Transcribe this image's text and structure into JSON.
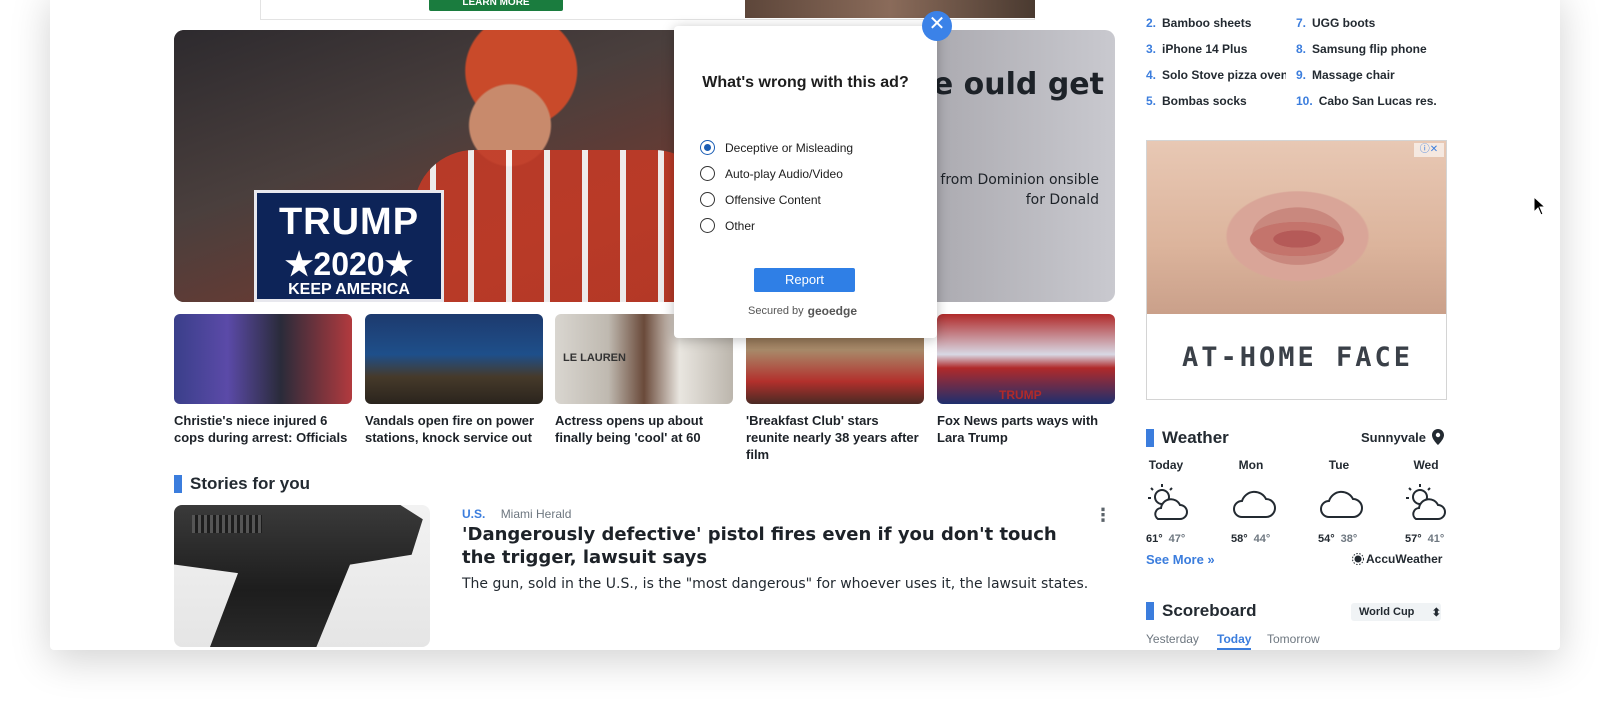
{
  "top_ad": {
    "button_label": "LEARN MORE"
  },
  "hero": {
    "title": "ght case ould get",
    "summary": "ws of amplifying bogus es from Dominion onsible for Donald",
    "sign_line1": "TRUMP",
    "sign_line2": "★2020★",
    "sign_line3": "KEEP AMERICA"
  },
  "thumbs": [
    {
      "caption": "Christie's niece injured 6 cops during arrest: Officials"
    },
    {
      "caption": "Vandals open fire on power stations, knock service out"
    },
    {
      "caption": "Actress opens up about finally being 'cool' at 60",
      "img_text": "LE  LAUREN"
    },
    {
      "caption": "'Breakfast Club' stars reunite nearly 38 years after film"
    },
    {
      "caption": "Fox News parts ways with Lara Trump",
      "img_text": "TRUMP"
    }
  ],
  "stories_header": "Stories for you",
  "story": {
    "category": "U.S.",
    "source": "Miami Herald",
    "title": "'Dangerously defective' pistol fires even if you don't touch the trigger, lawsuit says",
    "summary": "The gun, sold in the U.S., is the \"most dangerous\" for whoever uses it, the lawsuit states."
  },
  "trending": [
    {
      "num": "2.",
      "label": "Bamboo sheets"
    },
    {
      "num": "3.",
      "label": "iPhone 14 Plus"
    },
    {
      "num": "4.",
      "label": "Solo Stove pizza oven"
    },
    {
      "num": "5.",
      "label": "Bombas socks"
    },
    {
      "num": "7.",
      "label": "UGG boots"
    },
    {
      "num": "8.",
      "label": "Samsung flip phone"
    },
    {
      "num": "9.",
      "label": "Massage chair"
    },
    {
      "num": "10.",
      "label": "Cabo San Lucas res..."
    }
  ],
  "rail_ad": {
    "text": "AT-HOME FACE LIFT"
  },
  "weather": {
    "title": "Weather",
    "location": "Sunnyvale",
    "days": [
      {
        "day": "Today",
        "hi": "61°",
        "lo": "47°",
        "icon": "partly-cloudy-icon"
      },
      {
        "day": "Mon",
        "hi": "58°",
        "lo": "44°",
        "icon": "cloudy-icon"
      },
      {
        "day": "Tue",
        "hi": "54°",
        "lo": "38°",
        "icon": "cloudy-icon"
      },
      {
        "day": "Wed",
        "hi": "57°",
        "lo": "41°",
        "icon": "partly-cloudy-icon"
      }
    ],
    "see_more": "See More »",
    "provider": "AccuWeather"
  },
  "scoreboard": {
    "title": "Scoreboard",
    "league": "World Cup",
    "tabs": [
      "Yesterday",
      "Today",
      "Tomorrow"
    ],
    "active_tab": "Today"
  },
  "dialog": {
    "title": "What's wrong with this ad?",
    "options": [
      "Deceptive or Misleading",
      "Auto-play Audio/Video",
      "Offensive Content",
      "Other"
    ],
    "selected": "Deceptive or Misleading",
    "report_label": "Report",
    "secured_by": "Secured by",
    "vendor": "geoedge",
    "close_symbol": "✕"
  },
  "colors": {
    "accent": "#3b7ddd",
    "report_button": "#2f7fe6",
    "close_button": "#3b82e8",
    "cta_green": "#1a7c3e"
  }
}
